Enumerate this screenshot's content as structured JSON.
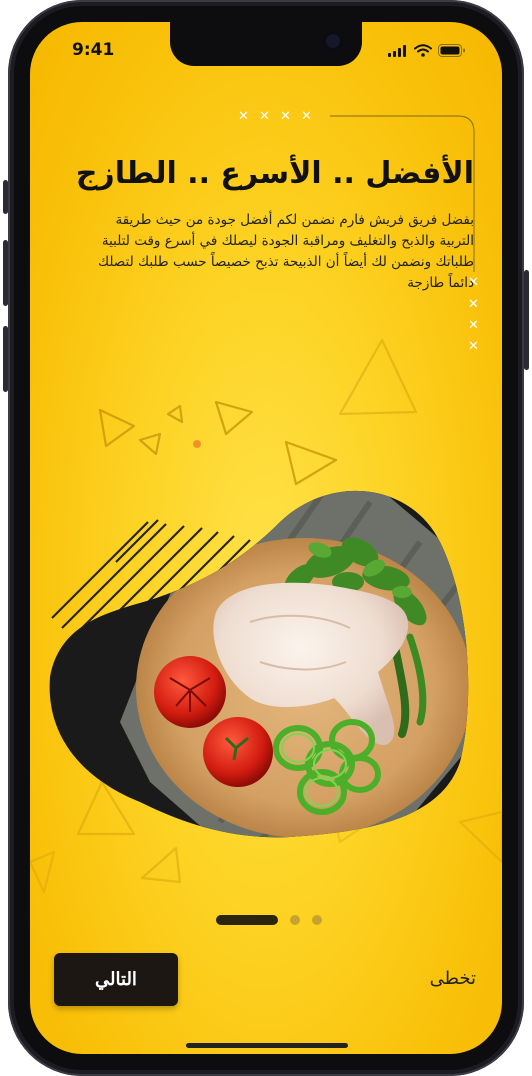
{
  "status_bar": {
    "time": "9:41"
  },
  "onboarding": {
    "title": "الأفضل .. الأسرع .. الطازج",
    "description": "بفضل فريق فريش فارم نضمن لكم أفضل جودة من حيث طريقة التربية والذبح والتغليف ومراقبة الجودة ليصلك في أسرع وقت لتلبية طلباتك ونضمن لك أيضاً أن الذبيحة تذبح خصيصاً حسب طلبك لتصلك دائماً طازجة"
  },
  "pagination": {
    "current": 1,
    "total": 3
  },
  "actions": {
    "next_label": "التالي",
    "skip_label": "تخطى"
  },
  "colors": {
    "background": "#fdd324",
    "button": "#1c1712",
    "accent_dot": "#f0922a"
  },
  "icons": {
    "signal": "cellular-signal-icon",
    "wifi": "wifi-icon",
    "battery": "battery-icon"
  }
}
